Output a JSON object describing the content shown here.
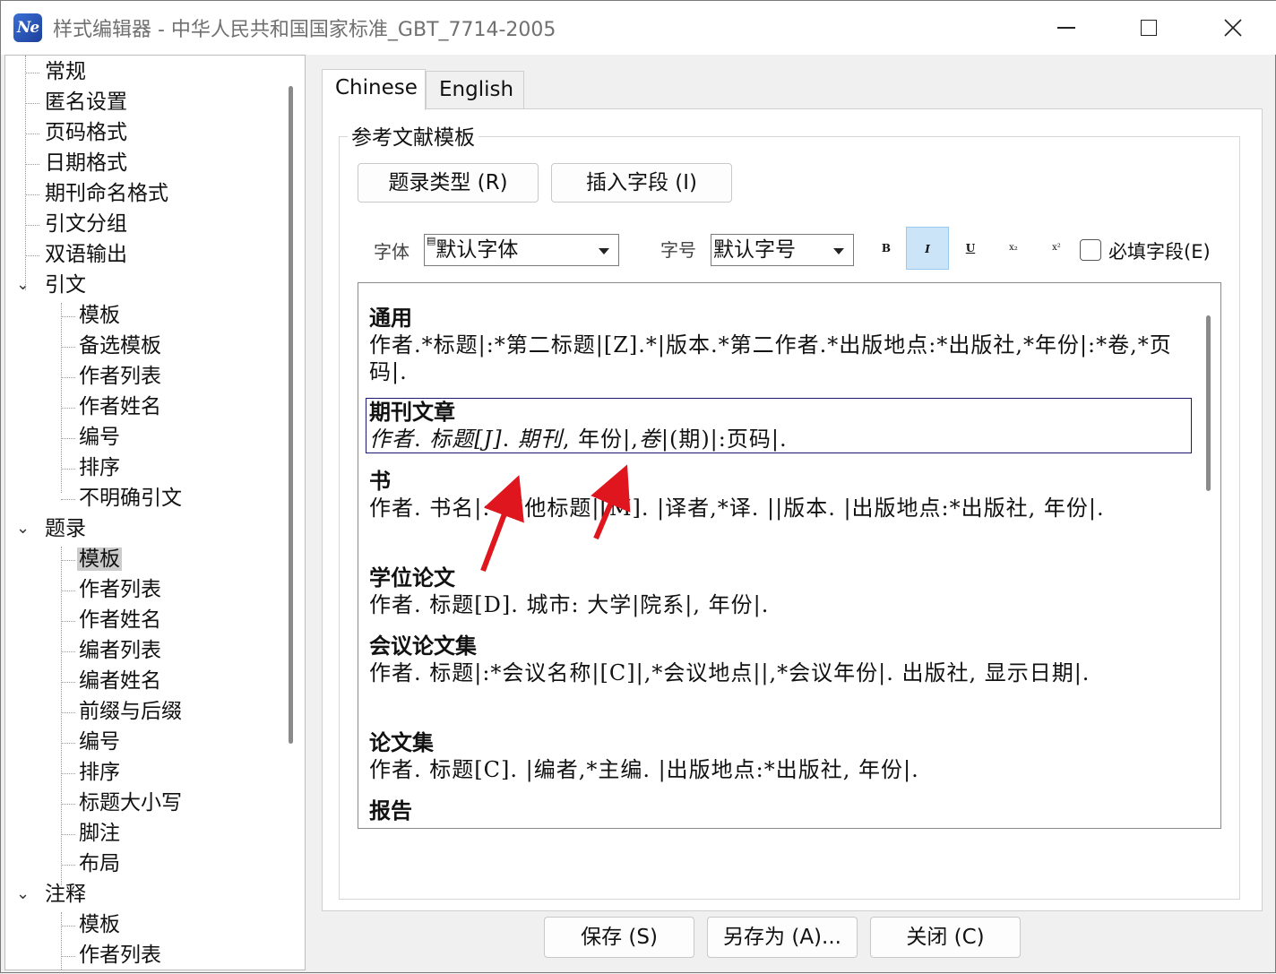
{
  "window": {
    "title": "样式编辑器 - 中华人民共和国国家标准_GBT_7714-2005",
    "app_icon_text": "Ne"
  },
  "tree": {
    "items": [
      {
        "label": "常规",
        "level": 0
      },
      {
        "label": "匿名设置",
        "level": 0
      },
      {
        "label": "页码格式",
        "level": 0
      },
      {
        "label": "日期格式",
        "level": 0
      },
      {
        "label": "期刊命名格式",
        "level": 0
      },
      {
        "label": "引文分组",
        "level": 0
      },
      {
        "label": "双语输出",
        "level": 0
      },
      {
        "label": "引文",
        "level": 0,
        "expanded": true
      },
      {
        "label": "模板",
        "level": 1
      },
      {
        "label": "备选模板",
        "level": 1
      },
      {
        "label": "作者列表",
        "level": 1
      },
      {
        "label": "作者姓名",
        "level": 1
      },
      {
        "label": "编号",
        "level": 1
      },
      {
        "label": "排序",
        "level": 1
      },
      {
        "label": "不明确引文",
        "level": 1
      },
      {
        "label": "题录",
        "level": 0,
        "expanded": true
      },
      {
        "label": "模板",
        "level": 1,
        "selected": true
      },
      {
        "label": "作者列表",
        "level": 1
      },
      {
        "label": "作者姓名",
        "level": 1
      },
      {
        "label": "编者列表",
        "level": 1
      },
      {
        "label": "编者姓名",
        "level": 1
      },
      {
        "label": "前缀与后缀",
        "level": 1
      },
      {
        "label": "编号",
        "level": 1
      },
      {
        "label": "排序",
        "level": 1
      },
      {
        "label": "标题大小写",
        "level": 1
      },
      {
        "label": "脚注",
        "level": 1
      },
      {
        "label": "布局",
        "level": 1
      },
      {
        "label": "注释",
        "level": 0,
        "expanded": true
      },
      {
        "label": "模板",
        "level": 1
      },
      {
        "label": "作者列表",
        "level": 1
      }
    ]
  },
  "tabs": [
    {
      "label": "Chinese",
      "active": true
    },
    {
      "label": "English",
      "active": false
    }
  ],
  "group_title": "参考文献模板",
  "buttons": {
    "ref_type": "题录类型 (R)",
    "insert_field": "插入字段 (I)",
    "save": "保存 (S)",
    "save_as": "另存为 (A)...",
    "close": "关闭 (C)"
  },
  "format_bar": {
    "font_label": "字体",
    "font_value": "默认字体",
    "size_label": "字号",
    "size_value": "默认字号",
    "bold": "B",
    "italic": "I",
    "underline": "U",
    "subscript": "x₂",
    "superscript": "x²",
    "italic_active": true,
    "required_label": "必填字段(E)",
    "required_checked": false
  },
  "templates": [
    {
      "title": "通用",
      "body": "作者.*标题|:*第二标题|[Z].*|版本.*第二作者.*出版地点:*出版社,*年份|:*卷,*页码|."
    },
    {
      "title": "期刊文章",
      "body_parts": [
        {
          "text": "作者",
          "italic": true
        },
        {
          "text": ". ",
          "italic": false
        },
        {
          "text": "标题",
          "italic": true
        },
        {
          "text": "[J]",
          "italic": true
        },
        {
          "text": ". ",
          "italic": false
        },
        {
          "text": "期刊",
          "italic": true
        },
        {
          "text": ", 年份|,",
          "italic": false
        },
        {
          "text": "卷",
          "italic": true
        },
        {
          "text": "|(期)|:页码|.",
          "italic": false
        }
      ],
      "selected": true
    },
    {
      "title": "书",
      "body": "作者. 书名|:*其他标题|[M]. |译者,*译. ||版本. |出版地点:*出版社, 年份|."
    },
    {
      "title": "学位论文",
      "body": "作者. 标题[D]. 城市: 大学|院系|, 年份|."
    },
    {
      "title": "会议论文集",
      "body": "作者. 标题|:*会议名称|[C]|,*会议地点||,*会议年份|. 出版社, 显示日期|."
    },
    {
      "title": "论文集",
      "body": "作者. 标题[C]. |编者,*主编. |出版地点:*出版社, 年份|."
    },
    {
      "title": "报告",
      "body": ""
    }
  ],
  "colors": {
    "annotation_arrow": "#e0161e",
    "selection_border": "#1a1a70",
    "italic_button_bg": "#cce4f7"
  }
}
